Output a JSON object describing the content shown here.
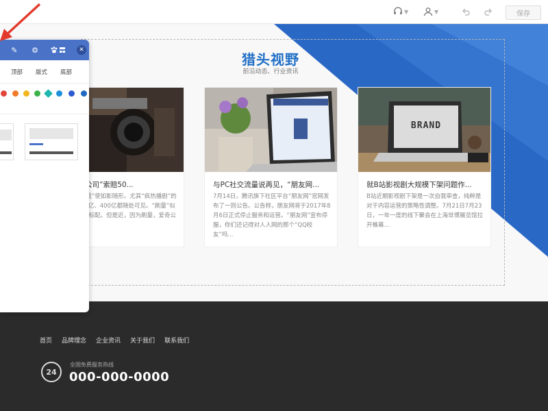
{
  "toolbar": {
    "save_label": "保存",
    "icons": [
      "headset-icon",
      "user-icon",
      "undo-icon",
      "redo-icon"
    ]
  },
  "section": {
    "title": "猎头视野",
    "subtitle": "前沿动态、行业资讯"
  },
  "articles": [
    {
      "title": "乐“刷量公司”索赔50...",
      "desc": "视频。“刷量”使如影随形。尤其“疯热播剧”的时代，300亿、400亿都随处可见。“刷量”似乎已经剧的标配。但是近，因为刷量，爱奇公司..."
    },
    {
      "title": "与PC社交流量说再见，“朋友网...",
      "desc": "7月14日，腾讯旗下社区平台“朋友网”官网发布了一则公告。公告称，朋友网将于2017年8月6日正式停止服务和运营。“朋友网”宣布停服，你们还记得对人人网的那个“QQ校友”吗..."
    },
    {
      "title": "就B站影视剧大规模下架问题作...",
      "desc": "B站近期影视剧下架是一次自我审查，纯粹是对于内容运营的策略性调整。7月21日7月23日，一年一度的线下聚会在上海世博展览馆拉开帷幕..."
    }
  ],
  "footer": {
    "nav": [
      "首页",
      "品牌理念",
      "企业资讯",
      "关于我们",
      "联系我们"
    ],
    "hotline_label": "全国免费服务热线",
    "hotline_icon_text": "24",
    "phone": "000-000-0000"
  },
  "panel": {
    "tabs": [
      "顶部",
      "版式",
      "底部"
    ],
    "swatch_colors": [
      "#e2463a",
      "#f07a2a",
      "#f2b51e",
      "#3cb24a",
      "#1fb6b0",
      "#1e8fd8",
      "#2a5bd0",
      "#1f68c0"
    ]
  }
}
